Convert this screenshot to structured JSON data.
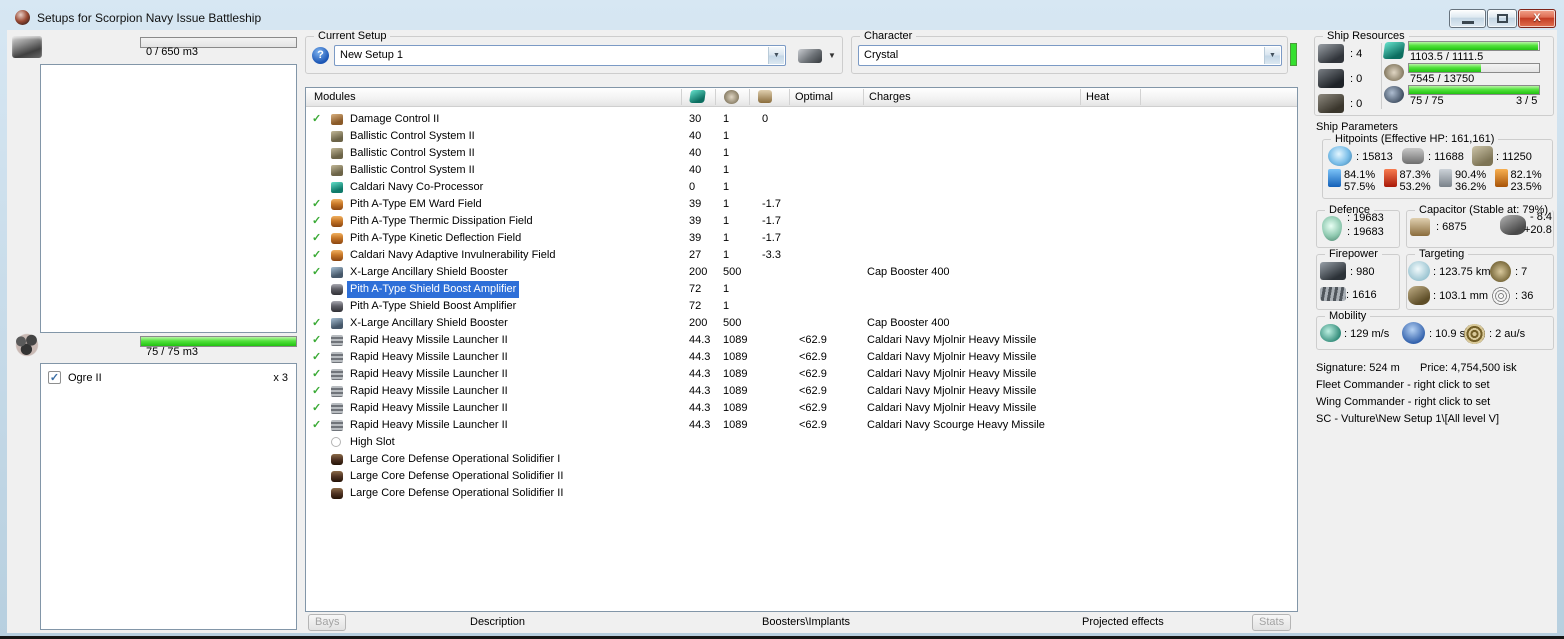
{
  "window": {
    "title": "Setups for Scorpion Navy Issue Battleship",
    "close_glyph": "X"
  },
  "icons": {
    "checkmark": "✓",
    "dropdown_arrow": "▼",
    "help": "?"
  },
  "left_panel": {
    "cargo_bay": {
      "capacity_label": "0 / 650 m3",
      "fill_pct": 0
    },
    "drone_bay": {
      "capacity_label": "75 / 75 m3",
      "fill_pct": 100,
      "items": [
        {
          "checked": true,
          "name": "Ogre II",
          "qty": "x 3"
        }
      ]
    }
  },
  "toolbar": {
    "current_setup": {
      "label": "Current Setup",
      "value": "New Setup 1"
    },
    "character": {
      "label": "Character",
      "value": "Crystal"
    }
  },
  "modules_table": {
    "header": {
      "modules": "Modules",
      "optimal": "Optimal",
      "charges": "Charges",
      "heat": "Heat"
    },
    "rows": [
      {
        "check": true,
        "icon": "damage-control",
        "name": "Damage Control II",
        "cpu": "30",
        "pg": "1",
        "cap": "0",
        "optimal": "",
        "charges": "",
        "heat": ""
      },
      {
        "check": false,
        "icon": "ballistic-control",
        "name": "Ballistic Control System II",
        "cpu": "40",
        "pg": "1",
        "cap": "",
        "optimal": "",
        "charges": "",
        "heat": ""
      },
      {
        "check": false,
        "icon": "ballistic-control",
        "name": "Ballistic Control System II",
        "cpu": "40",
        "pg": "1",
        "cap": "",
        "optimal": "",
        "charges": "",
        "heat": ""
      },
      {
        "check": false,
        "icon": "ballistic-control",
        "name": "Ballistic Control System II",
        "cpu": "40",
        "pg": "1",
        "cap": "",
        "optimal": "",
        "charges": "",
        "heat": ""
      },
      {
        "check": false,
        "icon": "co-processor",
        "name": "Caldari Navy Co-Processor",
        "cpu": "0",
        "pg": "1",
        "cap": "",
        "optimal": "",
        "charges": "",
        "heat": ""
      },
      {
        "check": true,
        "icon": "hardener",
        "name": "Pith A-Type EM Ward Field",
        "cpu": "39",
        "pg": "1",
        "cap": "-1.7",
        "optimal": "",
        "charges": "",
        "heat": ""
      },
      {
        "check": true,
        "icon": "hardener",
        "name": "Pith A-Type Thermic Dissipation Field",
        "cpu": "39",
        "pg": "1",
        "cap": "-1.7",
        "optimal": "",
        "charges": "",
        "heat": ""
      },
      {
        "check": true,
        "icon": "hardener",
        "name": "Pith A-Type Kinetic Deflection Field",
        "cpu": "39",
        "pg": "1",
        "cap": "-1.7",
        "optimal": "",
        "charges": "",
        "heat": ""
      },
      {
        "check": true,
        "icon": "hardener",
        "name": "Caldari Navy Adaptive Invulnerability Field",
        "cpu": "27",
        "pg": "1",
        "cap": "-3.3",
        "optimal": "",
        "charges": "",
        "heat": ""
      },
      {
        "check": true,
        "icon": "shield-booster",
        "name": "X-Large Ancillary Shield Booster",
        "cpu": "200",
        "pg": "500",
        "cap": "",
        "optimal": "",
        "charges": "Cap Booster 400",
        "heat": ""
      },
      {
        "check": false,
        "selected": true,
        "icon": "amplifier",
        "name": "Pith A-Type Shield Boost Amplifier",
        "cpu": "72",
        "pg": "1",
        "cap": "",
        "optimal": "",
        "charges": "",
        "heat": ""
      },
      {
        "check": false,
        "icon": "amplifier",
        "name": "Pith A-Type Shield Boost Amplifier",
        "cpu": "72",
        "pg": "1",
        "cap": "",
        "optimal": "",
        "charges": "",
        "heat": ""
      },
      {
        "check": true,
        "icon": "shield-booster",
        "name": "X-Large Ancillary Shield Booster",
        "cpu": "200",
        "pg": "500",
        "cap": "",
        "optimal": "",
        "charges": "Cap Booster 400",
        "heat": ""
      },
      {
        "check": true,
        "icon": "missile-launcher",
        "name": "Rapid Heavy Missile Launcher II",
        "cpu": "44.3",
        "pg": "1089",
        "cap": "",
        "optimal": "<62.9",
        "charges": "Caldari Navy Mjolnir Heavy Missile",
        "heat": ""
      },
      {
        "check": true,
        "icon": "missile-launcher",
        "name": "Rapid Heavy Missile Launcher II",
        "cpu": "44.3",
        "pg": "1089",
        "cap": "",
        "optimal": "<62.9",
        "charges": "Caldari Navy Mjolnir Heavy Missile",
        "heat": ""
      },
      {
        "check": true,
        "icon": "missile-launcher",
        "name": "Rapid Heavy Missile Launcher II",
        "cpu": "44.3",
        "pg": "1089",
        "cap": "",
        "optimal": "<62.9",
        "charges": "Caldari Navy Mjolnir Heavy Missile",
        "heat": ""
      },
      {
        "check": true,
        "icon": "missile-launcher",
        "name": "Rapid Heavy Missile Launcher II",
        "cpu": "44.3",
        "pg": "1089",
        "cap": "",
        "optimal": "<62.9",
        "charges": "Caldari Navy Mjolnir Heavy Missile",
        "heat": ""
      },
      {
        "check": true,
        "icon": "missile-launcher",
        "name": "Rapid Heavy Missile Launcher II",
        "cpu": "44.3",
        "pg": "1089",
        "cap": "",
        "optimal": "<62.9",
        "charges": "Caldari Navy Mjolnir Heavy Missile",
        "heat": ""
      },
      {
        "check": true,
        "icon": "missile-launcher",
        "name": "Rapid Heavy Missile Launcher II",
        "cpu": "44.3",
        "pg": "1089",
        "cap": "",
        "optimal": "<62.9",
        "charges": "Caldari Navy Scourge Heavy Missile",
        "heat": ""
      },
      {
        "check": false,
        "icon": "empty-slot",
        "name": "High Slot",
        "cpu": "",
        "pg": "",
        "cap": "",
        "optimal": "",
        "charges": "",
        "heat": ""
      },
      {
        "check": false,
        "icon": "rig",
        "name": "Large Core Defense Operational Solidifier I",
        "cpu": "",
        "pg": "",
        "cap": "",
        "optimal": "",
        "charges": "",
        "heat": ""
      },
      {
        "check": false,
        "icon": "rig",
        "name": "Large Core Defense Operational Solidifier II",
        "cpu": "",
        "pg": "",
        "cap": "",
        "optimal": "",
        "charges": "",
        "heat": ""
      },
      {
        "check": false,
        "icon": "rig",
        "name": "Large Core Defense Operational Solidifier II",
        "cpu": "",
        "pg": "",
        "cap": "",
        "optimal": "",
        "charges": "",
        "heat": ""
      }
    ]
  },
  "bottom_bar": {
    "bays_button": "Bays",
    "description_tab": "Description",
    "boosters_tab": "Boosters\\Implants",
    "projected_tab": "Projected effects",
    "stats_button": "Stats"
  },
  "right_panel": {
    "ship_resources": {
      "title": "Ship Resources",
      "hardpoints": [
        {
          "icon": "turret-hardpoints-icon",
          "value": ": 4"
        },
        {
          "icon": "launcher-hardpoints-icon",
          "value": ": 0"
        },
        {
          "icon": "rig-slots-icon",
          "value": ": 0"
        }
      ],
      "bars": [
        {
          "icon": "cpu-icon",
          "label": "1103.5 / 1111.5",
          "extra": "",
          "pct": 99
        },
        {
          "icon": "powergrid-icon",
          "label": "7545 / 13750",
          "extra": "",
          "pct": 55
        },
        {
          "icon": "dronebay-icon",
          "label": "75 / 75",
          "extra": "3 / 5",
          "pct": 100
        }
      ]
    },
    "ship_parameters": {
      "title": "Ship Parameters",
      "hitpoints": {
        "title": "Hitpoints (Effective HP: 161,161)",
        "shield": ": 15813",
        "armor": ": 11688",
        "hull": ": 11250",
        "resists": [
          {
            "type": "em",
            "shield": "84.1%",
            "armor": "57.5%"
          },
          {
            "type": "thermal",
            "shield": "87.3%",
            "armor": "53.2%"
          },
          {
            "type": "kinetic",
            "shield": "90.4%",
            "armor": "36.2%"
          },
          {
            "type": "explosive",
            "shield": "82.1%",
            "armor": "23.5%"
          }
        ]
      },
      "defence": {
        "title": "Defence",
        "line1": ": 19683",
        "line2": ": 19683"
      },
      "capacitor": {
        "title": "Capacitor (Stable at: 79%)",
        "amount": ": 6875",
        "usage": "- 8.4",
        "recharge": "+20.8"
      },
      "firepower": {
        "title": "Firepower",
        "dps": ": 980",
        "volley": ": 1616"
      },
      "targeting": {
        "title": "Targeting",
        "range": ": 123.75 km",
        "max_targets": ": 7",
        "scan_resolution": ": 103.1 mm",
        "sensor_strength": ": 36"
      },
      "mobility": {
        "title": "Mobility",
        "speed": ": 129 m/s",
        "align_time": ": 10.9 s",
        "warp_speed": ": 2 au/s"
      },
      "footer": {
        "signature": "Signature: 524 m",
        "price": "Price: 4,754,500 isk",
        "fleet_commander": "Fleet Commander - right click to set",
        "wing_commander": "Wing Commander - right click to set",
        "sc": "SC - Vulture\\New Setup 1\\[All level V]"
      }
    }
  },
  "colors": {
    "selection": "#2e6fd8",
    "bar_green": "#35d41f",
    "check_green": "#3aaa35",
    "character_status": "#35e02f"
  }
}
